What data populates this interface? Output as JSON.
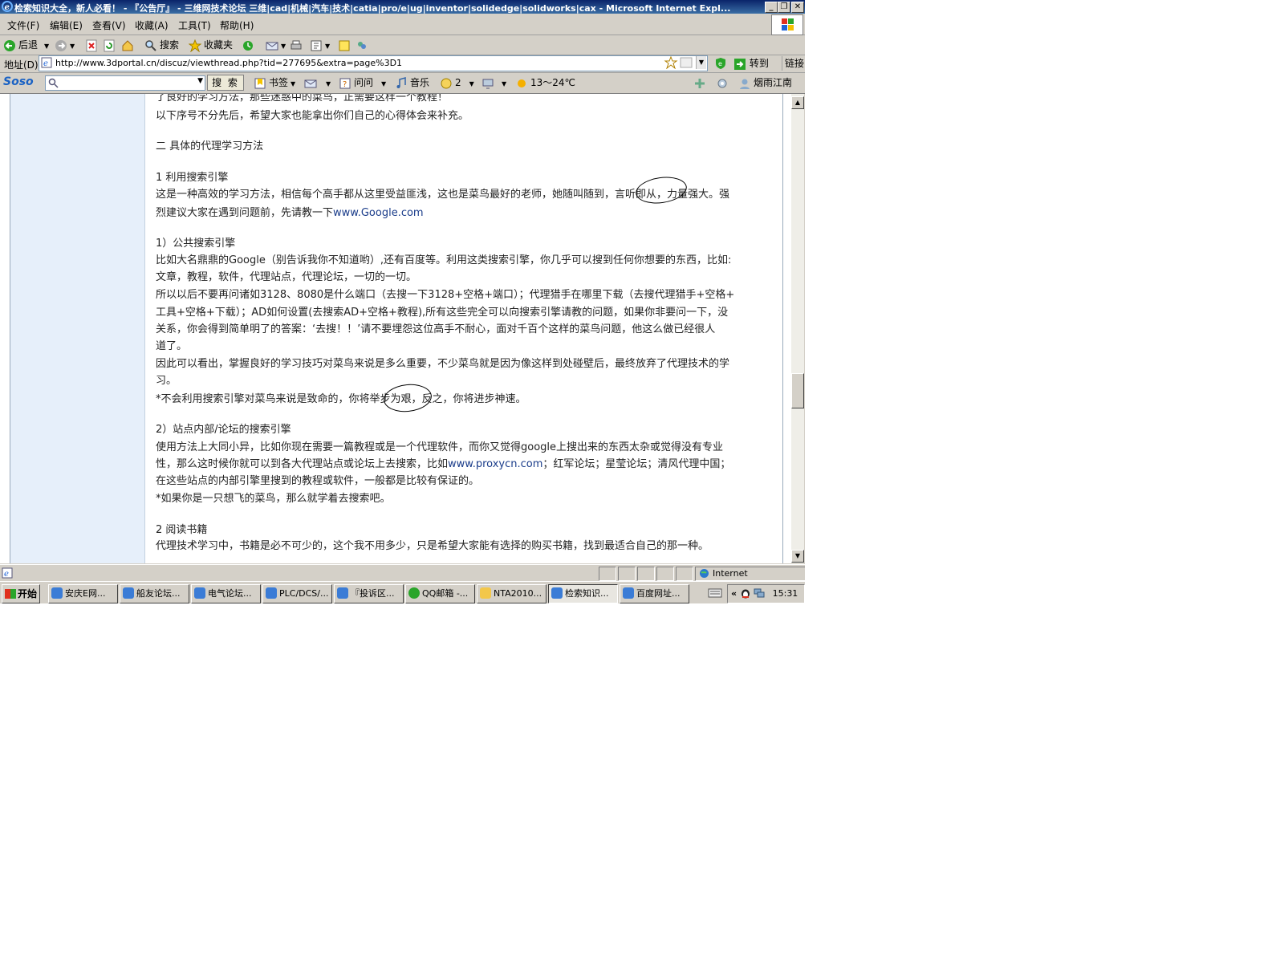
{
  "window": {
    "title": "检索知识大全，新人必看！ - 『公告厅』 - 三维网技术论坛 三维|cad|机械|汽车|技术|catia|pro/e|ug|inventor|solidedge|solidworks|cax - Microsoft Internet Expl..."
  },
  "menu": {
    "items": [
      "文件(F)",
      "编辑(E)",
      "查看(V)",
      "收藏(A)",
      "工具(T)",
      "帮助(H)"
    ]
  },
  "toolbar": {
    "back_label": "后退",
    "search_label": "搜索",
    "favorites_label": "收藏夹"
  },
  "address": {
    "label": "地址(D)",
    "url": "http://www.3dportal.cn/discuz/viewthread.php?tid=277695&extra=page%3D1",
    "go_label": "转到",
    "links_label": "链接"
  },
  "soso": {
    "logo": "Soso",
    "search_button": "搜 索",
    "bookmark_label": "书签",
    "ask_label": "问问",
    "music_label": "音乐",
    "count": "2",
    "weather": "13～24℃",
    "user": "烟雨江南"
  },
  "article": {
    "lines": [
      "了良好的学习方法，那些迷惑中的菜鸟，正需要这样一个教程！",
      "以下序号不分先后，希望大家也能拿出你们自己的心得体会来补充。",
      "二 具体的代理学习方法",
      "1 利用搜索引擎",
      "这是一种高效的学习方法，相信每个高手都从这里受益匪浅，这也是菜鸟最好的老师，她随叫随到，言听即从，力量强大。强",
      "烈建议大家在遇到问题前，先请教一下",
      "www.Google.com",
      "1）公共搜索引擎",
      "比如大名鼎鼎的Google（别告诉我你不知道哟）,还有百度等。利用这类搜索引擎，你几乎可以搜到任何你想要的东西，比如:",
      "文章，教程，软件，代理站点，代理论坛，一切的一切。",
      "所以以后不要再问诸如3128、8080是什么端口（去搜一下3128+空格+端口）；代理猎手在哪里下载（去搜代理猎手+空格+",
      "工具+空格+下载）；AD如何设置(去搜索AD+空格+教程),所有这些完全可以向搜索引擎请教的问题，如果你非要问一下，没",
      "关系，你会得到简单明了的答案：‘去搜！！’请不要埋怨这位高手不耐心，面对千百个这样的菜鸟问题，他这么做已经很人",
      "道了。",
      "因此可以看出，掌握良好的学习技巧对菜鸟来说是多么重要，不少菜鸟就是因为像这样到处碰壁后，最终放弃了代理技术的学",
      "习。",
      "*不会利用搜索引擎对菜鸟来说是致命的，你将举步为艰，反之，你将进步神速。",
      "2）站点内部/论坛的搜索引擎",
      "使用方法上大同小异，比如你现在需要一篇教程或是一个代理软件，而你又觉得google上搜出来的东西太杂或觉得没有专业",
      "性，那么这时候你就可以到各大代理站点或论坛上去搜索，比如",
      "www.proxycn.com",
      "；红军论坛；星莹论坛；清风代理中国；",
      "在这些站点的内部引擎里搜到的教程或软件，一般都是比较有保证的。",
      "*如果你是一只想飞的菜鸟，那么就学着去搜索吧。",
      "2 阅读书籍",
      "代理技术学习中，书籍是必不可少的，这个我不用多少，只是希望大家能有选择的购买书籍，找到最适合自己的那一种。"
    ]
  },
  "status": {
    "zone": "Internet"
  },
  "taskbar": {
    "start_label": "开始",
    "tasks": [
      "安庆E网...",
      "船友论坛...",
      "电气论坛...",
      "PLC/DCS/...",
      "『投诉区...",
      "QQ邮箱 -...",
      "NTA2010...",
      "检索知识...",
      "百度网址..."
    ],
    "clock": "15:31"
  },
  "colors": {
    "titlebar": "#0a246a",
    "sidebar": "#e6effa",
    "link": "#1a3c8a"
  }
}
